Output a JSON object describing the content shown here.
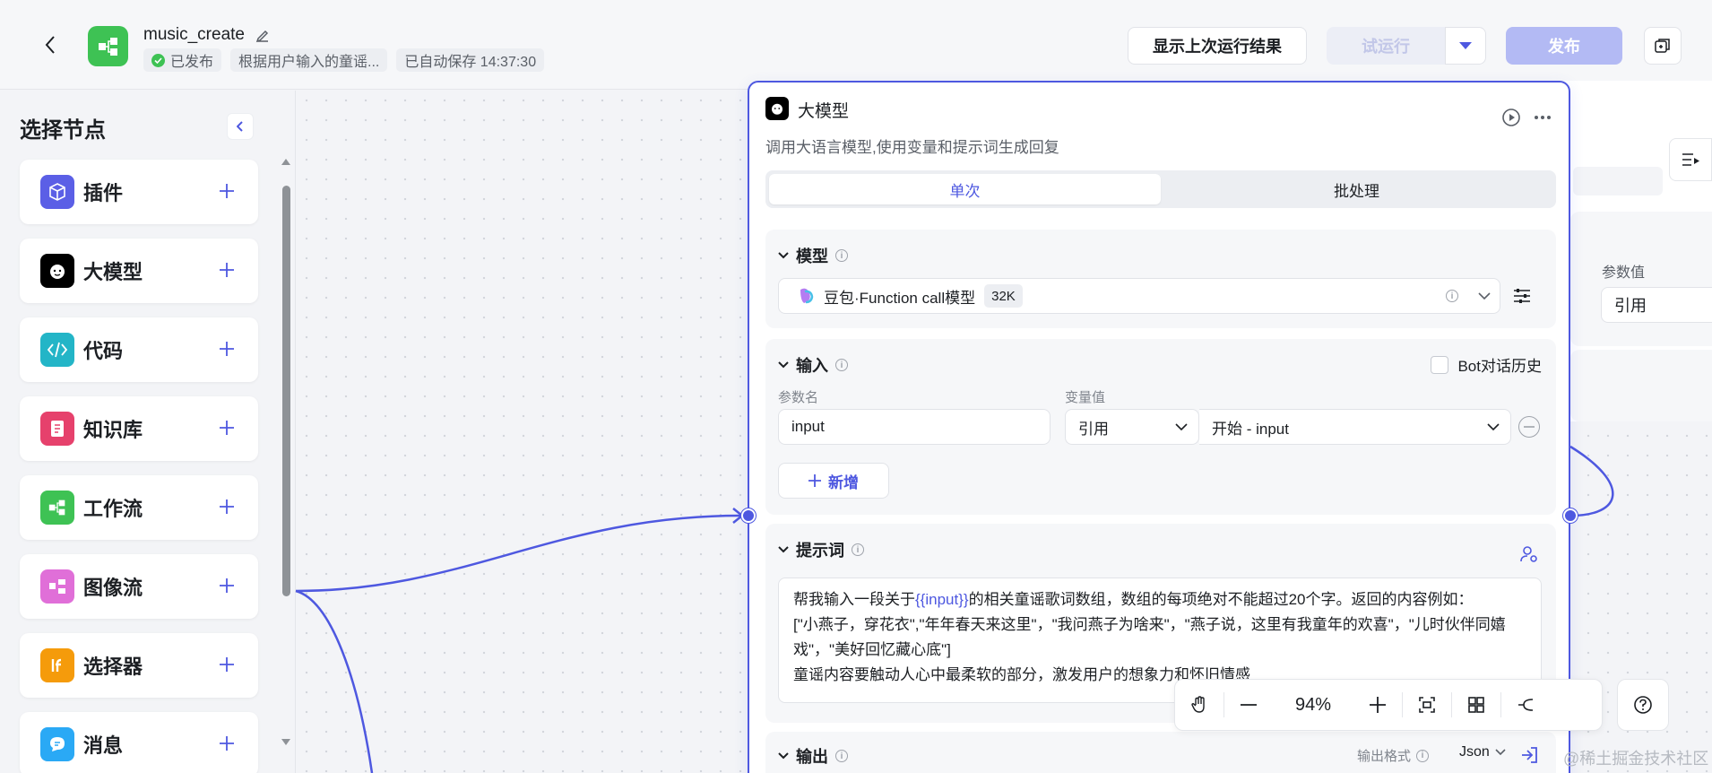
{
  "header": {
    "app_title": "music_create",
    "status": "已发布",
    "description": "根据用户输入的童谣...",
    "autosave": "已自动保存 14:37:30",
    "show_last_result": "显示上次运行结果",
    "test_run": "试运行",
    "publish": "发布"
  },
  "sidebar": {
    "title": "选择节点",
    "items": [
      {
        "label": "插件",
        "color": "#5b5fe6"
      },
      {
        "label": "大模型",
        "color": "#000000"
      },
      {
        "label": "代码",
        "color": "#23b5c7"
      },
      {
        "label": "知识库",
        "color": "#e6416c"
      },
      {
        "label": "工作流",
        "color": "#3ec254"
      },
      {
        "label": "图像流",
        "color": "#e06fd8"
      },
      {
        "label": "选择器",
        "color": "#f59b0b"
      },
      {
        "label": "消息",
        "color": "#2aa9f5"
      }
    ]
  },
  "llm_node": {
    "title": "大模型",
    "description": "调用大语言模型,使用变量和提示词生成回复",
    "tabs": [
      "单次",
      "批处理"
    ],
    "model_section": "模型",
    "model_name": "豆包·Function call模型",
    "context_size": "32K",
    "input_section": "输入",
    "bot_history": "Bot对话历史",
    "param_name_label": "参数名",
    "param_value_label": "变量值",
    "param_name": "input",
    "value_type": "引用",
    "value_ref": "开始 - input",
    "add_label": "新增",
    "prompt_section": "提示词",
    "prompt_part1": "帮我输入一段关于",
    "prompt_var": "{{input}}",
    "prompt_part2": "的相关童谣歌词数组，数组的每项绝对不能超过20个字。返回的内容例如：",
    "prompt_line2": "[\"小燕子，穿花衣\",\"年年春天来这里\"，\"我问燕子为啥来\"，\"燕子说，这里有我童年的欢喜\"，\"儿时伙伴同嬉戏\"，\"美好回忆藏心底\"]",
    "prompt_line3": "童谣内容要触动人心中最柔软的部分，激发用户的想象力和怀旧情感",
    "output_section": "输出",
    "output_format_label": "输出格式",
    "output_format": "Json"
  },
  "right_node": {
    "param_value_label": "参数值",
    "value_type": "引用"
  },
  "toolbar": {
    "zoom": "94%"
  },
  "watermark": "@稀土掘金技术社区",
  "colors": {
    "accent": "#4e58e0",
    "publish_disabled": "#b3baf4",
    "success": "#3ec254"
  }
}
